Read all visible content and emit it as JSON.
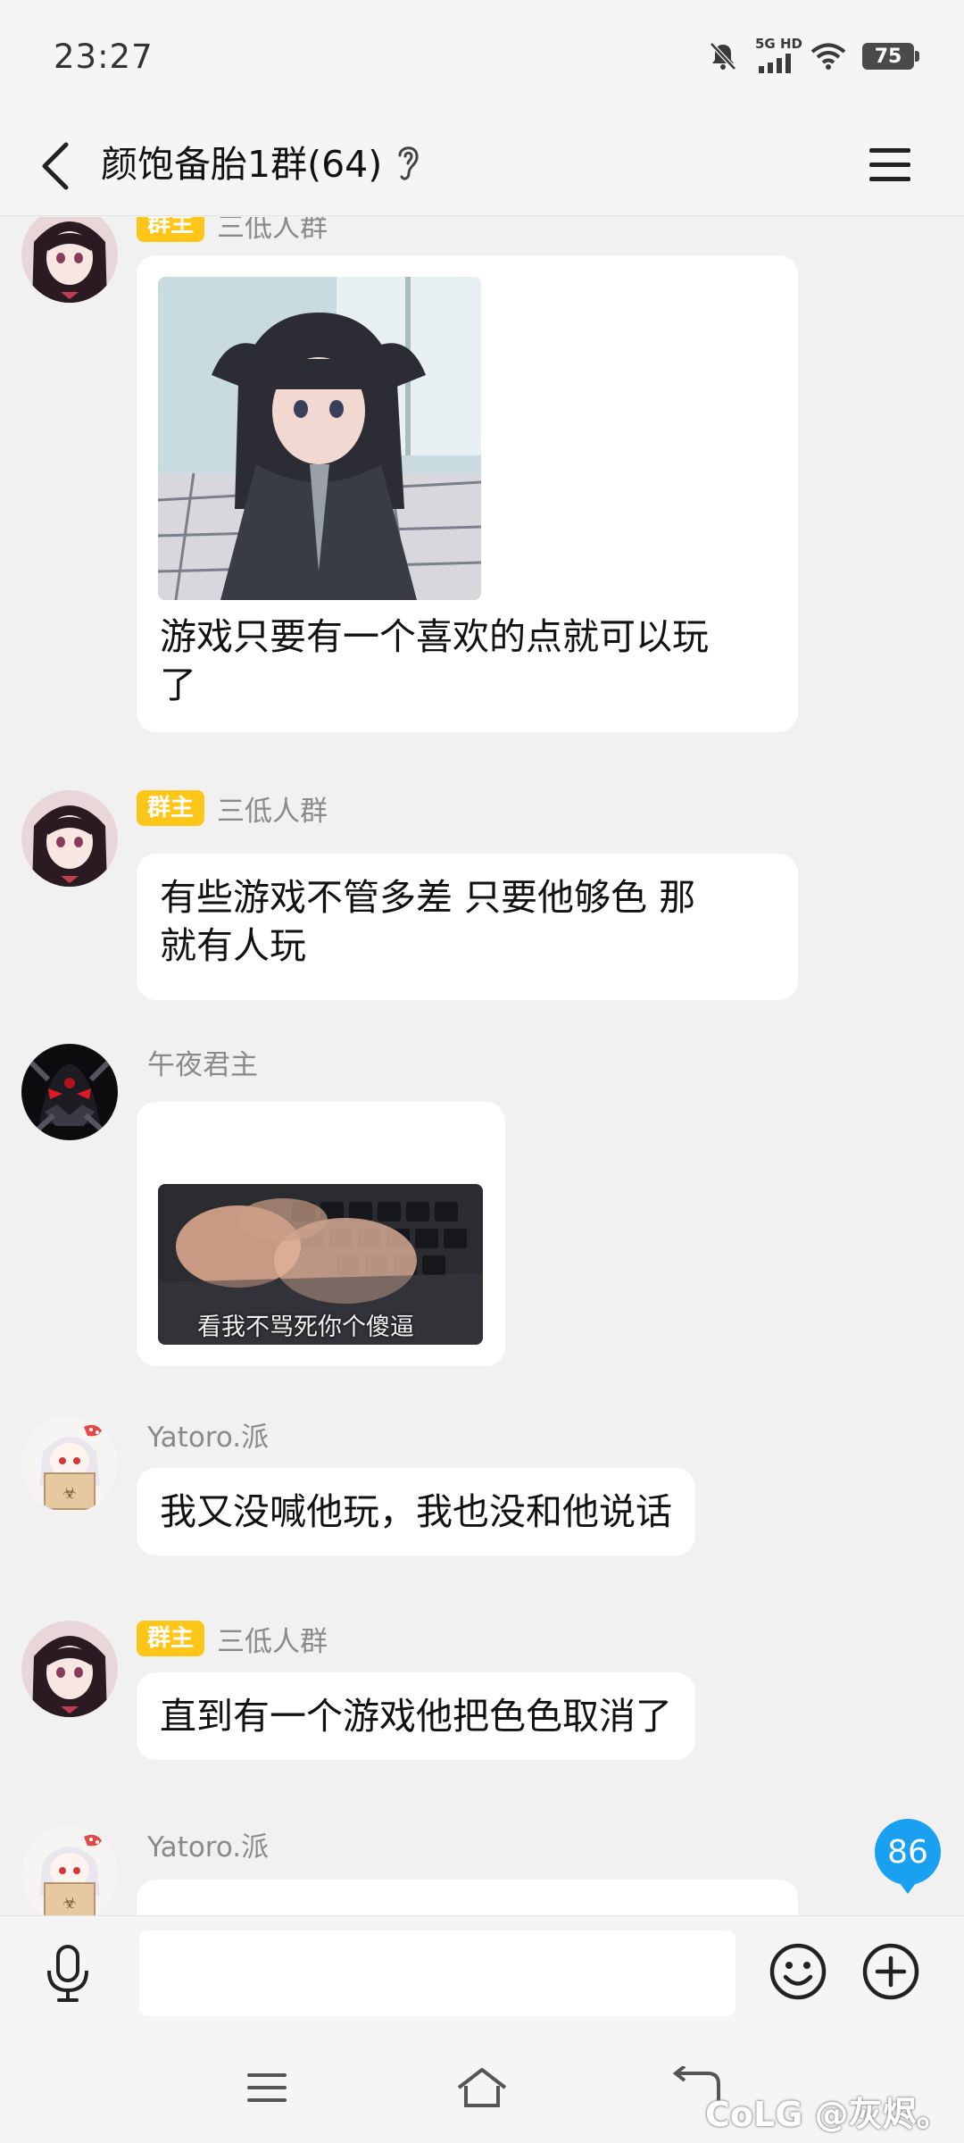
{
  "status_bar": {
    "time": "23:27",
    "network_label": "5G HD",
    "battery": "75",
    "icons": [
      "mute-bell-icon",
      "signal-icon",
      "wifi-icon",
      "battery-icon"
    ]
  },
  "header": {
    "title": "颜饱备胎1群(64)",
    "icons": [
      "back-arrow-icon",
      "ear-icon",
      "menu-icon"
    ]
  },
  "messages": [
    {
      "badge": "群主",
      "sender": "三低人群",
      "image": "anime-girl-sticker",
      "text": "游戏只要有一个喜欢的点就可以玩了",
      "text_lines": [
        "游戏只要有一个喜欢的点就可以玩",
        "了"
      ]
    },
    {
      "badge": "群主",
      "sender": "三低人群",
      "text": "有些游戏不管多差 只要他够色 那就有人玩",
      "text_lines": [
        "有些游戏不管多差 只要他够色 那",
        "就有人玩"
      ]
    },
    {
      "sender": "午夜君主",
      "image": "typing-hands-sticker",
      "image_caption": "看我不骂死你个傻逼"
    },
    {
      "sender": "Yatoro.派",
      "text": "我又没喊他玩，我也没和他说话"
    },
    {
      "badge": "群主",
      "sender": "三低人群",
      "text": "直到有一个游戏他把色色取消了"
    },
    {
      "sender": "Yatoro.派"
    }
  ],
  "unread_count": "86",
  "input_bar": {
    "placeholder": "",
    "icons": [
      "microphone-icon",
      "emoji-icon",
      "plus-icon"
    ]
  },
  "nav_bar": {
    "icons": [
      "recent-apps-icon",
      "home-icon",
      "back-icon"
    ],
    "watermark": "CoLG @灰烬。"
  },
  "colors": {
    "background": "#f1f1f1",
    "bubble": "#ffffff",
    "owner_badge": "#ffc61a",
    "unread_badge": "#1aa0f0"
  }
}
